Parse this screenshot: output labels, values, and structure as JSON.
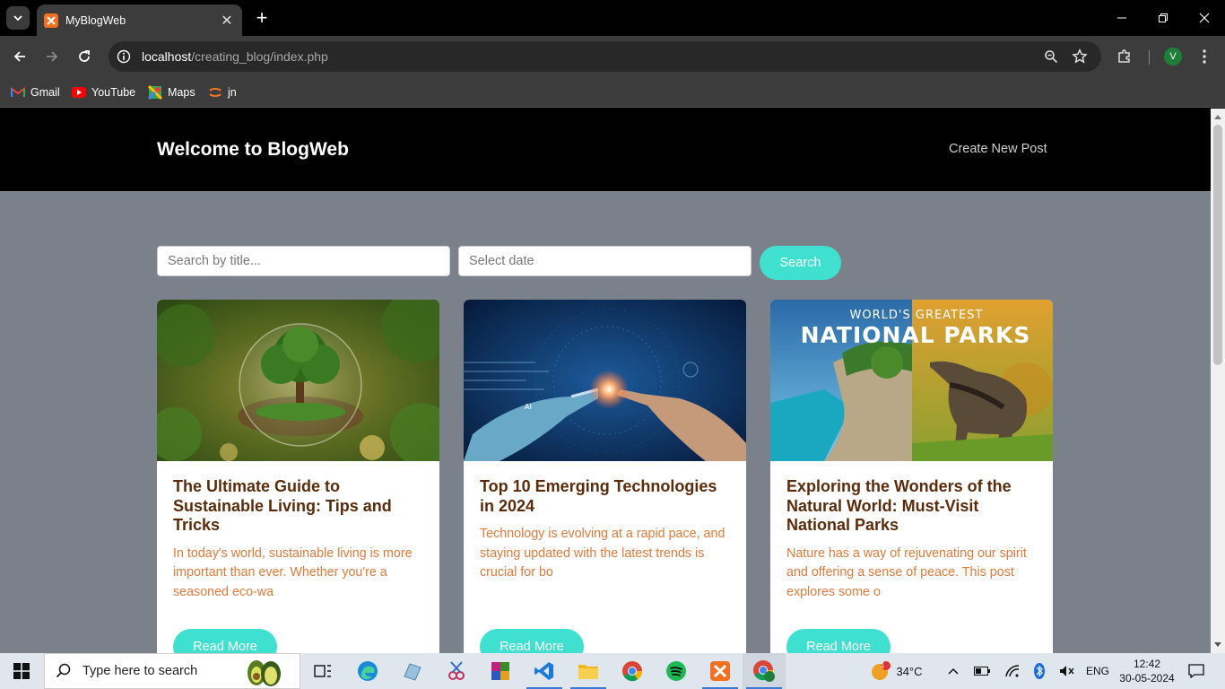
{
  "browser": {
    "tab_title": "MyBlogWeb",
    "url_host": "localhost",
    "url_path": "/creating_blog/index.php",
    "profile_initial": "V",
    "bookmarks": [
      {
        "label": "Gmail",
        "icon": "gmail-icon"
      },
      {
        "label": "YouTube",
        "icon": "youtube-icon"
      },
      {
        "label": "Maps",
        "icon": "maps-icon"
      },
      {
        "label": "jn",
        "icon": "jupyter-icon"
      }
    ]
  },
  "header": {
    "title": "Welcome to BlogWeb",
    "create_link": "Create New Post"
  },
  "search": {
    "title_placeholder": "Search by title...",
    "date_placeholder": "Select date",
    "button_label": "Search"
  },
  "posts": [
    {
      "title": "The Ultimate Guide to Sustainable Living: Tips and Tricks",
      "excerpt": "In today's world, sustainable living is more important than ever. Whether you're a seasoned eco-wa",
      "read_more": "Read More",
      "image": "tree-in-glass-sphere-image"
    },
    {
      "title": "Top 10 Emerging Technologies in 2024",
      "excerpt": "Technology is evolving at a rapid pace, and staying updated with the latest trends is crucial for bo",
      "read_more": "Read More",
      "image": "ai-robot-hand-image"
    },
    {
      "title": "Exploring the Wonders of the Natural World: Must-Visit National Parks",
      "excerpt": "Nature has a way of rejuvenating our spirit and offering a sense of peace. This post explores some o",
      "read_more": "Read More",
      "image": "national-parks-image",
      "image_text_top": "WORLD'S GREATEST",
      "image_text_main": "NATIONAL PARKS"
    }
  ],
  "ai_image_labels": {
    "ai": "AI"
  },
  "taskbar": {
    "search_placeholder": "Type here to search",
    "weather_temp": "34°C",
    "weather_badge": "1",
    "language": "ENG",
    "time": "12:42",
    "date": "30-05-2024"
  },
  "colors": {
    "accent": "#40e0d0",
    "title": "#5b2c0c",
    "excerpt": "#e07a3a",
    "page_bg": "#7b818b"
  }
}
